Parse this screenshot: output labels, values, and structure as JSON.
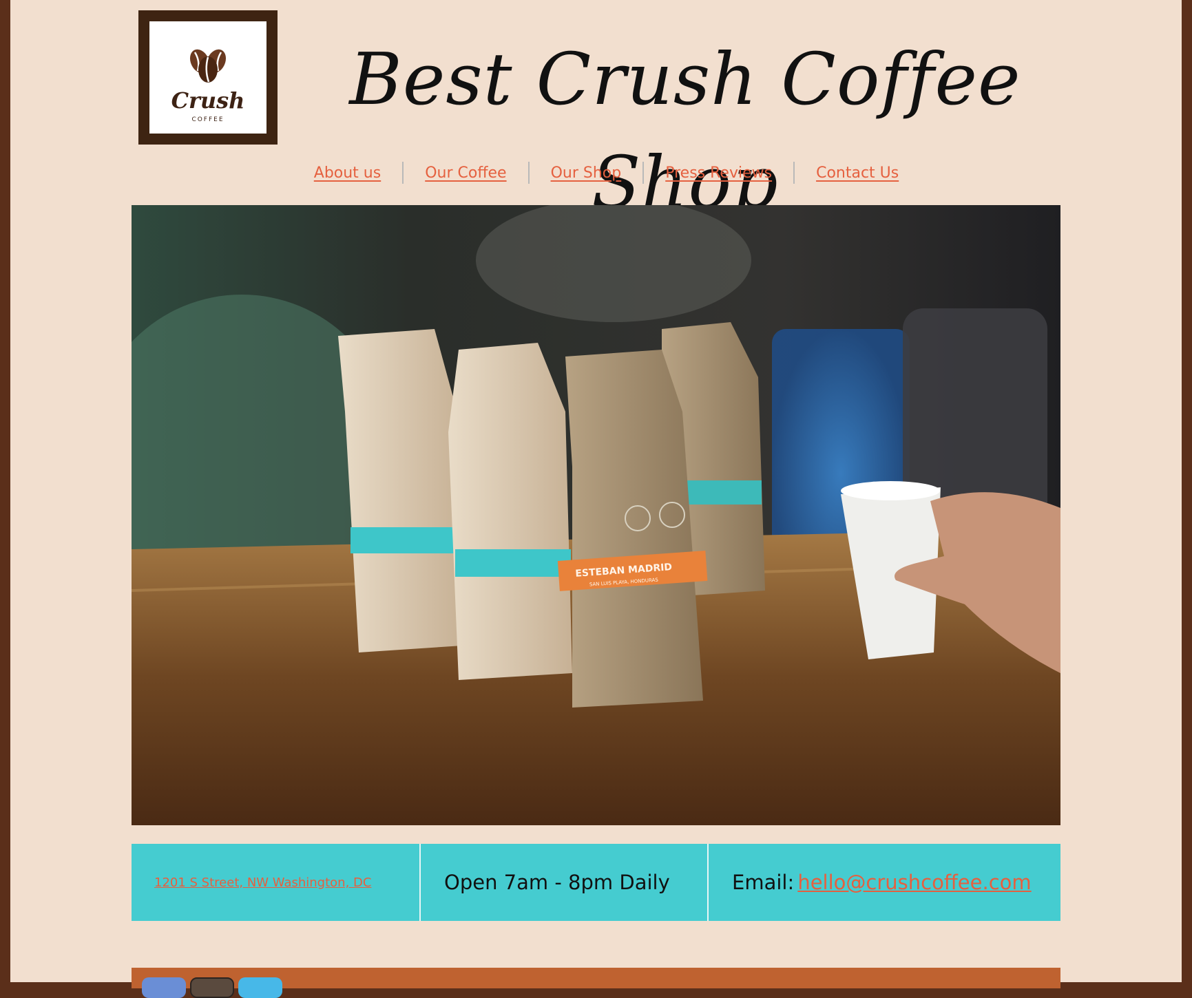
{
  "logo": {
    "name": "Crush",
    "tagline": "COFFEE"
  },
  "header": {
    "title": "Best Crush Coffee Shop"
  },
  "nav": {
    "items": [
      {
        "label": "About us"
      },
      {
        "label": "Our Coffee"
      },
      {
        "label": "Our Shop"
      },
      {
        "label": "Press Reviews"
      },
      {
        "label": "Contact Us"
      }
    ]
  },
  "hero": {
    "bag_labels": [
      "ESTEBAN MADRID",
      "SAN LUIS PLAYA, HONDURAS"
    ]
  },
  "info": {
    "address": "1201 S Street, NW Washington, DC",
    "hours": "Open 7am - 8pm Daily",
    "email_label": "Email: ",
    "email": "hello@crushcoffee.com"
  },
  "social": [
    {
      "icon": "facebook-icon"
    },
    {
      "icon": "instagram-icon"
    },
    {
      "icon": "twitter-icon"
    }
  ],
  "colors": {
    "accent": "#e5603f",
    "info_bar": "#45ccd0",
    "footer": "#bf6230",
    "page_bg": "#f2dfcf",
    "frame": "#5b2f1a"
  }
}
